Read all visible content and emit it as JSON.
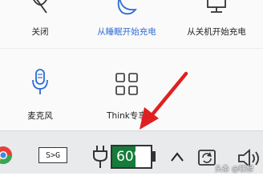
{
  "power_panel": {
    "tiles": [
      {
        "label": "关闭",
        "icon": "power-off-icon"
      },
      {
        "label": "从睡眠开始充电",
        "icon": "moon-sleep-icon"
      },
      {
        "label": "从关机开始充电",
        "icon": "monitor-off-icon"
      },
      {
        "label": "麦克风",
        "icon": "microphone-icon"
      },
      {
        "label": "Think专享",
        "icon": "apps-grid-icon"
      }
    ]
  },
  "taskbar": {
    "shortcut_label": "S>G",
    "battery_percent": "60%",
    "battery_level": 0.6,
    "items": [
      "chrome-icon",
      "plug-icon",
      "battery-icon",
      "chevron-up-icon",
      "sync-icon",
      "volume-icon"
    ]
  },
  "watermark": "头条 @联想",
  "colors": {
    "accent_blue": "#2f6bd6",
    "battery_fill": "#167c3a",
    "arrow_red": "#e02020"
  }
}
